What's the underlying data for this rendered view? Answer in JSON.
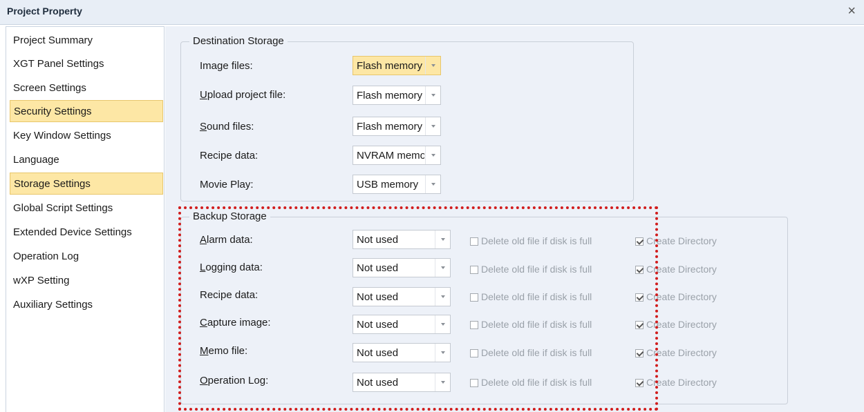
{
  "window": {
    "title": "Project Property",
    "close_glyph": "×"
  },
  "sidebar": {
    "items": [
      {
        "label": "Project Summary",
        "selected": false
      },
      {
        "label": "XGT Panel Settings",
        "selected": false
      },
      {
        "label": "Screen Settings",
        "selected": false
      },
      {
        "label": "Security Settings",
        "selected": true
      },
      {
        "label": "Key Window Settings",
        "selected": false
      },
      {
        "label": "Language",
        "selected": false
      },
      {
        "label": "Storage Settings",
        "selected": true
      },
      {
        "label": "Global Script Settings",
        "selected": false
      },
      {
        "label": "Extended Device Settings",
        "selected": false
      },
      {
        "label": "Operation Log",
        "selected": false
      },
      {
        "label": "wXP Setting",
        "selected": false
      },
      {
        "label": "Auxiliary Settings",
        "selected": false
      }
    ]
  },
  "destination": {
    "title": "Destination Storage",
    "rows": [
      {
        "acc": "",
        "rest": "Image files:",
        "value": "Flash memory"
      },
      {
        "acc": "U",
        "rest": "pload project file:",
        "value": "Flash memory"
      },
      {
        "acc": "S",
        "rest": "ound files:",
        "value": "Flash memory"
      },
      {
        "acc": "",
        "rest": "Recipe data:",
        "value": "NVRAM memory"
      },
      {
        "acc": "",
        "rest": "Movie Play:",
        "value": "USB memory"
      }
    ]
  },
  "backup": {
    "title": "Backup Storage",
    "delete_label": "Delete old file if disk is full",
    "create_label": "Create Directory",
    "rows": [
      {
        "acc": "A",
        "rest": "larm data:",
        "value": "Not used"
      },
      {
        "acc": "L",
        "rest": "ogging data:",
        "value": "Not used"
      },
      {
        "acc": "",
        "rest": "Recipe data:",
        "value": "Not used"
      },
      {
        "acc": "C",
        "rest": "apture image:",
        "value": "Not used"
      },
      {
        "acc": "M",
        "rest": "emo file:",
        "value": "Not used"
      },
      {
        "acc": "O",
        "rest": "peration Log:",
        "value": "Not used"
      }
    ]
  },
  "colors": {
    "selection": "#fde7a5",
    "panel_bg": "#edf1f8",
    "highlight_border": "#d11d1d"
  }
}
